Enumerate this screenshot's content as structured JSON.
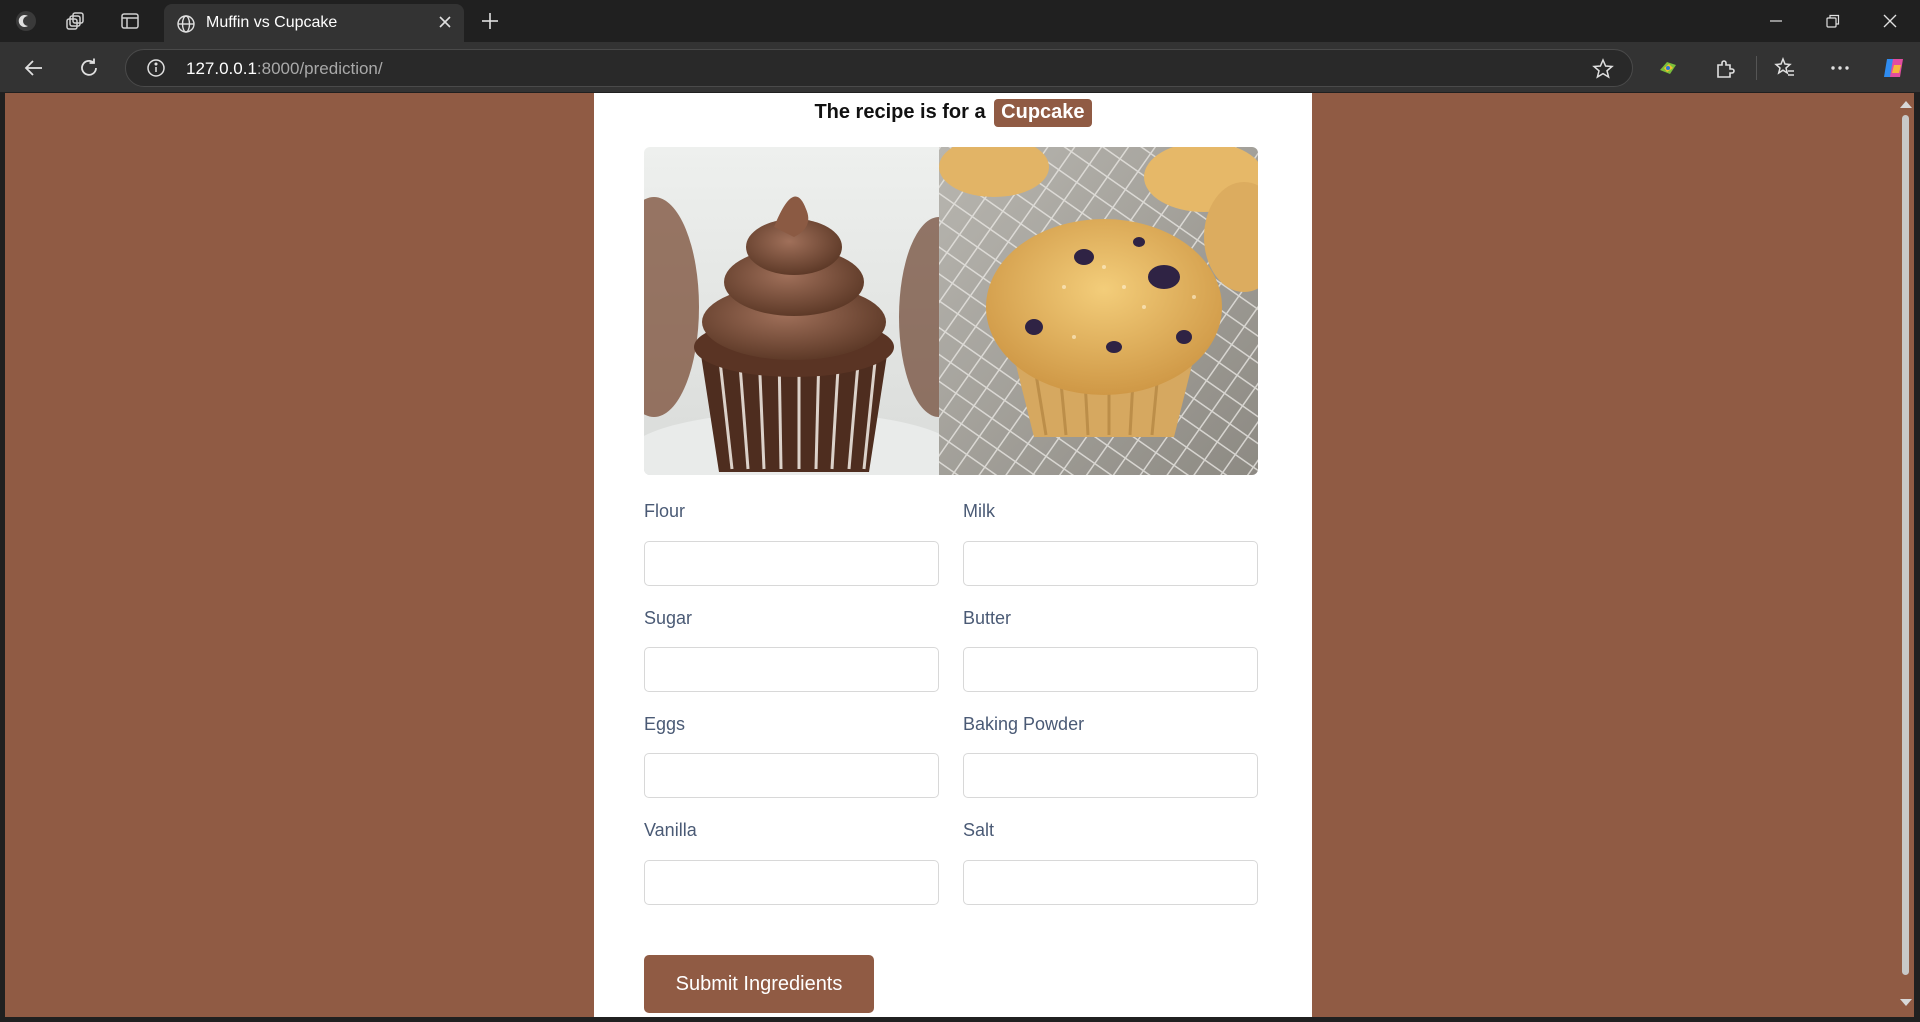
{
  "browser": {
    "tab_title": "Muffin vs Cupcake",
    "url_host": "127.0.0.1",
    "url_rest": ":8000/prediction/"
  },
  "page": {
    "heading_prefix": "The recipe is for a",
    "result": "Cupcake",
    "image_alt": "Cupcake and muffin",
    "fields": [
      {
        "label": "Flour",
        "value": ""
      },
      {
        "label": "Milk",
        "value": ""
      },
      {
        "label": "Sugar",
        "value": ""
      },
      {
        "label": "Butter",
        "value": ""
      },
      {
        "label": "Eggs",
        "value": ""
      },
      {
        "label": "Baking Powder",
        "value": ""
      },
      {
        "label": "Vanilla",
        "value": ""
      },
      {
        "label": "Salt",
        "value": ""
      }
    ],
    "submit_label": "Submit Ingredients"
  },
  "colors": {
    "brand": "#905b44",
    "label": "#4a5a75"
  }
}
